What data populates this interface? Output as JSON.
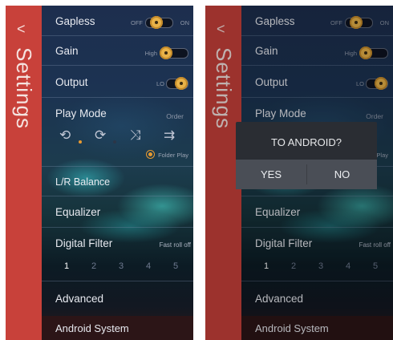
{
  "sidebar": {
    "back_glyph": "<",
    "title": "Settings"
  },
  "rows": {
    "gapless": {
      "label": "Gapless",
      "off": "OFF",
      "on": "ON"
    },
    "gain": {
      "label": "Gain",
      "value": "High"
    },
    "output": {
      "label": "Output",
      "value": "LO"
    },
    "play_mode": {
      "label": "Play Mode",
      "value": "Order",
      "folder_play": "Folder Play"
    },
    "balance": {
      "label": "L/R Balance"
    },
    "equalizer": {
      "label": "Equalizer"
    },
    "digital_filter": {
      "label": "Digital Filter",
      "value": "Fast roll off",
      "options": [
        "1",
        "2",
        "3",
        "4",
        "5"
      ],
      "selected": "1"
    },
    "advanced": {
      "label": "Advanced"
    },
    "android": {
      "label": "Android System"
    }
  },
  "icons": {
    "repeat_one": "⟲",
    "repeat_all": "⟳",
    "shuffle": "⤨",
    "order": "⇉"
  },
  "dialog": {
    "title": "TO ANDROID?",
    "yes": "YES",
    "no": "NO"
  },
  "colors": {
    "sidebar": "#c8413a",
    "knob": "#e8b248",
    "accent": "#e89a30"
  }
}
